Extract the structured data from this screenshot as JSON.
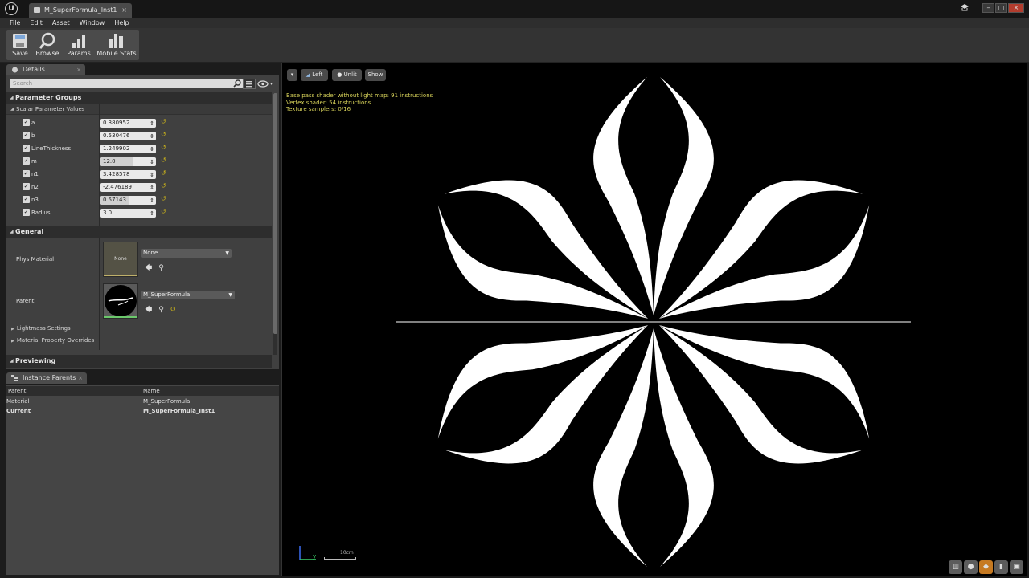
{
  "window": {
    "logo": "U",
    "tab_title": "M_SuperFormula_Inst1",
    "tab_close": "×"
  },
  "menu": [
    "File",
    "Edit",
    "Asset",
    "Window",
    "Help"
  ],
  "toolbar": {
    "save": "Save",
    "browse": "Browse",
    "params": "Params",
    "mobile_stats": "Mobile Stats"
  },
  "details": {
    "tab_label": "Details",
    "search_placeholder": "Search",
    "parameter_groups": "Parameter Groups",
    "scalar_group": "Scalar Parameter Values",
    "params": [
      {
        "name": "a",
        "value": "0.380952",
        "checked": true,
        "fill": 0
      },
      {
        "name": "b",
        "value": "0.530476",
        "checked": true,
        "fill": 0
      },
      {
        "name": "LineThickness",
        "value": "1.249902",
        "checked": true,
        "fill": 0
      },
      {
        "name": "m",
        "value": "12.0",
        "checked": true,
        "fill": 0.6
      },
      {
        "name": "n1",
        "value": "3.428578",
        "checked": true,
        "fill": 0
      },
      {
        "name": "n2",
        "value": "-2.476189",
        "checked": true,
        "fill": 0
      },
      {
        "name": "n3",
        "value": "0.57143",
        "checked": true,
        "fill": 0.5
      },
      {
        "name": "Radius",
        "value": "3.0",
        "checked": true,
        "fill": 0
      }
    ],
    "general": "General",
    "phys_material_label": "Phys Material",
    "phys_material_thumb": "None",
    "phys_material_value": "None",
    "parent_label": "Parent",
    "parent_value": "M_SuperFormula",
    "lightmass": "Lightmass Settings",
    "material_overrides": "Material Property Overrides",
    "previewing": "Previewing"
  },
  "instance_parents": {
    "tab_label": "Instance Parents",
    "col_parent": "Parent",
    "col_name": "Name",
    "rows": [
      {
        "parent": "Material",
        "name": "M_SuperFormula"
      },
      {
        "parent": "Current",
        "name": "M_SuperFormula_Inst1"
      }
    ]
  },
  "viewport": {
    "btn_left": "Left",
    "btn_unlit": "Unlit",
    "btn_show": "Show",
    "stats": [
      "Base pass shader without light map: 91 instructions",
      "Vertex shader: 54 instructions",
      "Texture samplers: 0/16"
    ],
    "scale_label": "10cm",
    "axis_label": "y"
  },
  "colors": {
    "accent": "#c67a22",
    "reset_arrow": "#c9b11a",
    "stats_text": "#d8d35a"
  }
}
